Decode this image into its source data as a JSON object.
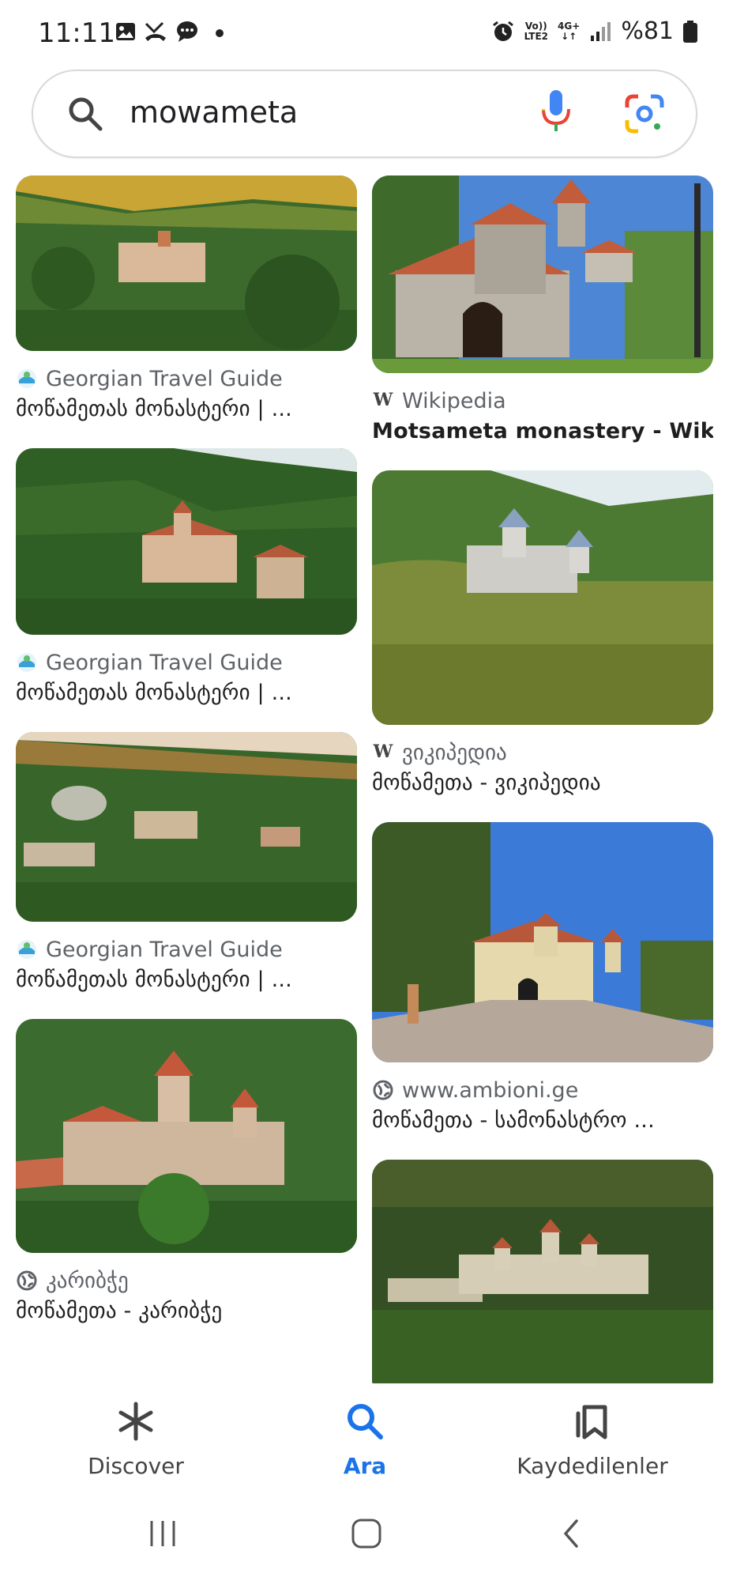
{
  "status_bar": {
    "time": "11:11",
    "network_top": "Vo))",
    "network_bottom": "LTE2",
    "data_top": "4G+",
    "battery": "%81"
  },
  "search": {
    "query": "mowameta"
  },
  "results": {
    "left": [
      {
        "source": "Georgian Travel Guide",
        "title": "მოწამეთას მონასტერი | ...",
        "source_icon": "georgian-travel-guide-icon"
      },
      {
        "source": "Georgian Travel Guide",
        "title": "მოწამეთას მონასტერი | ...",
        "source_icon": "georgian-travel-guide-icon"
      },
      {
        "source": "Georgian Travel Guide",
        "title": "მოწამეთას მონასტერი | ...",
        "source_icon": "georgian-travel-guide-icon"
      },
      {
        "source": "კარიბჭე",
        "title": "მოწამეთა - კარიბჭე",
        "source_icon": "globe-icon"
      }
    ],
    "right": [
      {
        "source": "Wikipedia",
        "title": "Motsameta monastery - Wiki...",
        "source_icon": "wikipedia-icon"
      },
      {
        "source": "ვიკიპედია",
        "title": "მოწამეთა - ვიკიპედია",
        "source_icon": "wikipedia-icon"
      },
      {
        "source": "www.ambioni.ge",
        "title": "მოწამეთა - სამონასტრო ...",
        "source_icon": "globe-icon"
      },
      {
        "source": "",
        "title": "",
        "source_icon": ""
      }
    ]
  },
  "bottom_nav": {
    "discover": "Discover",
    "search": "Ara",
    "saved": "Kaydedilenler"
  },
  "colors": {
    "accent": "#1a73e8",
    "text_primary": "#1f1f1f",
    "text_secondary": "#5f6368"
  }
}
